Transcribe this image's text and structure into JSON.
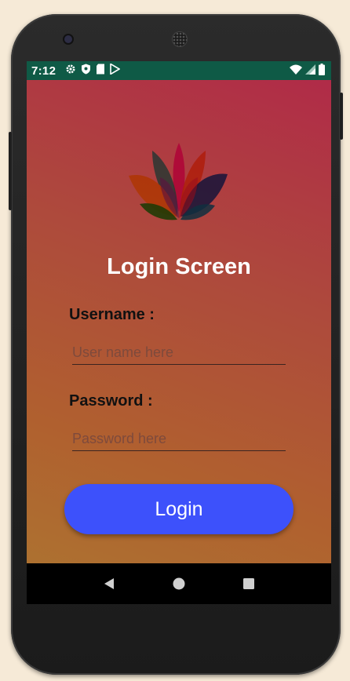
{
  "status_bar": {
    "time": "7:12",
    "left_icons": [
      "gear-icon",
      "shield-icon",
      "sd-card-icon",
      "play-store-icon"
    ],
    "right_icons": [
      "wifi-icon",
      "signal-icon",
      "battery-icon"
    ],
    "color": "#0f5a46"
  },
  "app": {
    "title": "Login Screen",
    "username": {
      "label": "Username :",
      "placeholder": "User name here",
      "value": ""
    },
    "password": {
      "label": "Password :",
      "placeholder": "Password here",
      "value": ""
    },
    "login_button": "Login",
    "colors": {
      "button": "#3d51fb",
      "background_top": "#b02b48",
      "background_bottom": "#ad7130"
    }
  },
  "nav_bar": {
    "buttons": [
      "back-icon",
      "home-icon",
      "recents-icon"
    ]
  }
}
